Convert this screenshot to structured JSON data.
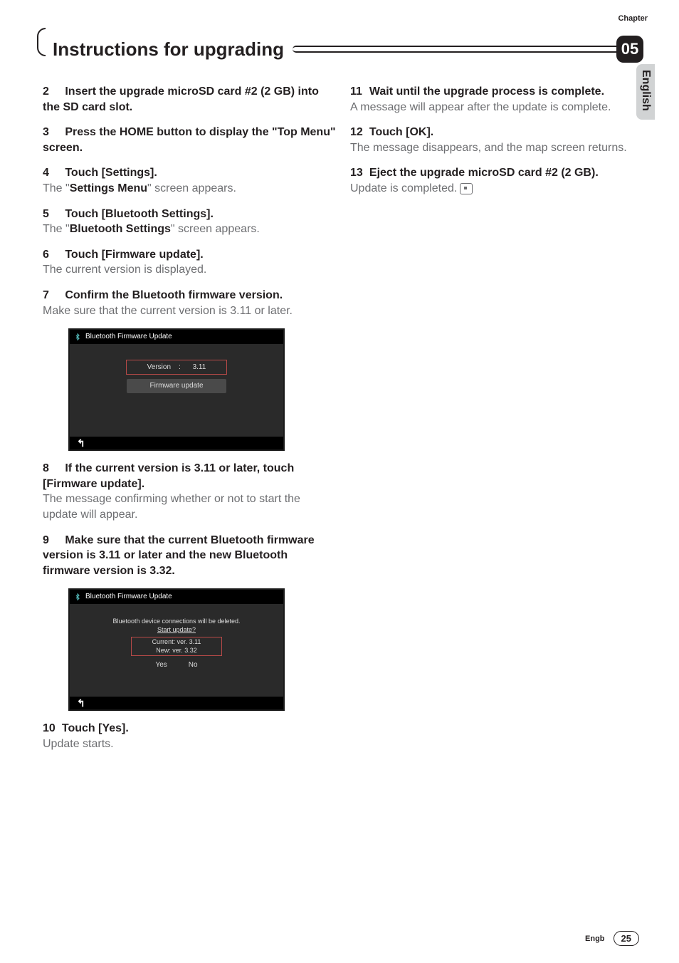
{
  "header": {
    "chapter_label": "Chapter",
    "chapter_number": "05",
    "title": "Instructions for upgrading",
    "side_tab": "English"
  },
  "left_col": {
    "steps": [
      {
        "num": "2",
        "head": "Insert the upgrade microSD card #2 (2 GB) into the SD card slot."
      },
      {
        "num": "3",
        "head": "Press the HOME button to display the \"Top Menu\" screen."
      },
      {
        "num": "4",
        "head": "Touch [Settings].",
        "body_pre": "The \"",
        "body_bold": "Settings Menu",
        "body_post": "\" screen appears."
      },
      {
        "num": "5",
        "head": "Touch [Bluetooth Settings].",
        "body_pre": "The \"",
        "body_bold": "Bluetooth Settings",
        "body_post": "\" screen appears."
      },
      {
        "num": "6",
        "head": "Touch [Firmware update].",
        "body_plain": "The current version is displayed."
      },
      {
        "num": "7",
        "head": "Confirm the Bluetooth firmware version.",
        "body_plain": "Make sure that the current version is 3.11 or later."
      }
    ],
    "shot1": {
      "title": "Bluetooth Firmware Update",
      "version_label": "Version",
      "version_sep": ":",
      "version_value": "3.11",
      "fw_label": "Firmware update"
    },
    "steps2": [
      {
        "num": "8",
        "head": "If the current version is 3.11 or later, touch [Firmware update].",
        "body_plain": "The message confirming whether or not to start the update will appear."
      },
      {
        "num": "9",
        "head": "Make sure that the current Bluetooth firmware version is 3.11 or later and the new Bluetooth firmware version is 3.32."
      }
    ],
    "shot2": {
      "title": "Bluetooth Firmware Update",
      "msg1": "Bluetooth device connections will be deleted.",
      "msg2": "Start update?",
      "current": "Current: ver. 3.11",
      "new": "New: ver. 3.32",
      "yes": "Yes",
      "no": "No"
    },
    "steps3": [
      {
        "num": "10",
        "head": "Touch [Yes].",
        "body_plain": "Update starts."
      }
    ]
  },
  "right_col": {
    "steps": [
      {
        "num": "11",
        "head": "Wait until the upgrade process is complete.",
        "body_plain": "A message will appear after the update is complete."
      },
      {
        "num": "12",
        "head": "Touch [OK].",
        "body_plain": "The message disappears, and the map screen returns."
      },
      {
        "num": "13",
        "head": "Eject the upgrade microSD card #2 (2 GB).",
        "body_plain": "Update is completed."
      }
    ]
  },
  "footer": {
    "lang": "Engb",
    "page": "25"
  }
}
